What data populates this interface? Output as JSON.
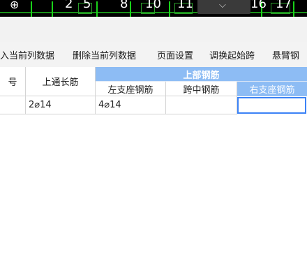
{
  "cad_strip": {
    "numbers": [
      "2",
      "5",
      "8",
      "10",
      "11",
      "16",
      "17"
    ],
    "dropdown_icon": "chevron-down-icon"
  },
  "toolbar": {
    "insert_column_data": "入当前列数据",
    "delete_column_data": "删除当前列数据",
    "page_settings": "页面设置",
    "adjust_start_span": "调换起始跨",
    "cantilever_rebar": "悬臂钢"
  },
  "table": {
    "col_number_header": "号",
    "col_top_through_header": "上通长筋",
    "group_top_rebar_header": "上部钢筋",
    "sub_left_support_header": "左支座钢筋",
    "sub_mid_span_header": "跨中钢筋",
    "sub_right_support_header": "右支座钢筋",
    "row1": {
      "number": "",
      "top_through": "2⌀14",
      "left_support": "4⌀14",
      "mid_span": "",
      "right_support": ""
    }
  },
  "colors": {
    "header_blue": "#8dbcf4",
    "selection_blue": "#3b82f6"
  }
}
